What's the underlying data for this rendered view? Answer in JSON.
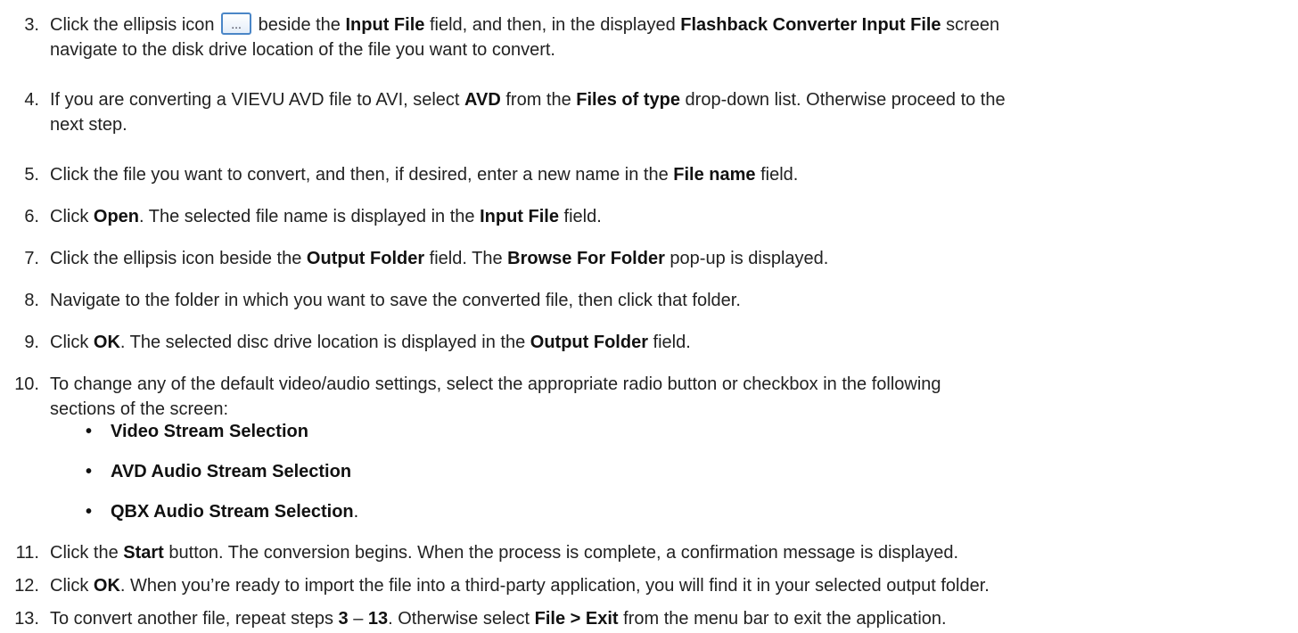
{
  "steps": [
    {
      "num": "3.",
      "parts": [
        "Click the ellipsis icon ",
        " beside the ",
        "Input File",
        " field, and then, in the displayed ",
        "Flashback Converter Input File",
        " screen",
        "navigate to the disk drive location of the file you want to convert."
      ]
    },
    {
      "num": "4.",
      "parts": [
        "If you are converting a VIEVU AVD file to AVI, select ",
        "AVD",
        " from the ",
        "Files of type",
        " drop-down list. Otherwise proceed to the",
        "next step."
      ]
    },
    {
      "num": "5.",
      "parts": [
        "Click the file you want to convert, and then, if desired, enter a new name in the ",
        "File name",
        " field."
      ]
    },
    {
      "num": "6.",
      "parts": [
        "Click ",
        "Open",
        ". The selected file name is displayed in the ",
        "Input File",
        " field."
      ]
    },
    {
      "num": "7.",
      "parts": [
        "Click the ellipsis icon beside the ",
        "Output Folder",
        " field. The ",
        "Browse For Folder",
        " pop-up is displayed."
      ]
    },
    {
      "num": "8.",
      "parts": [
        "Navigate to the folder in which you want to save the converted file, then click that folder."
      ]
    },
    {
      "num": "9.",
      "parts": [
        "Click ",
        "OK",
        ". The selected disc drive location is displayed in the ",
        "Output Folder",
        " field."
      ]
    },
    {
      "num": "10.",
      "parts": [
        "To change any of the default video/audio settings, select the appropriate radio button or checkbox in the following",
        "sections of the screen:"
      ]
    },
    {
      "num": "11.",
      "parts": [
        "Click the ",
        "Start",
        " button. The conversion begins. When the process is complete, a confirmation message is displayed."
      ]
    },
    {
      "num": "12.",
      "parts": [
        "Click ",
        "OK",
        ". When you’re ready to import the file into a third-party application, you will find it in your selected output folder."
      ]
    },
    {
      "num": "13.",
      "parts": [
        "To convert another file, repeat steps ",
        "3",
        " – ",
        "13",
        ". Otherwise select ",
        "File > Exit",
        " from the menu bar to exit the application."
      ]
    }
  ],
  "bullets": [
    {
      "label": "Video Stream Selection",
      "suffix": ""
    },
    {
      "label": "AVD Audio Stream Selection",
      "suffix": ""
    },
    {
      "label": "QBX Audio Stream Selection",
      "suffix": "."
    }
  ],
  "bullet_symbol": "•",
  "ellipsis_glyph": "...",
  "icons": {
    "ellipsis": "ellipsis-button-icon"
  }
}
